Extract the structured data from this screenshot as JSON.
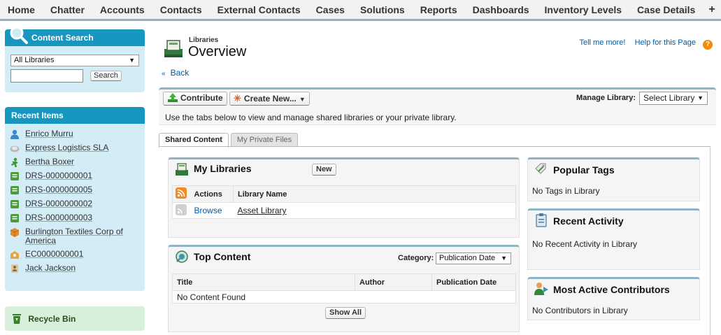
{
  "top_tabs": [
    "Home",
    "Chatter",
    "Accounts",
    "Contacts",
    "External Contacts",
    "Cases",
    "Solutions",
    "Reports",
    "Dashboards",
    "Inventory Levels",
    "Case Details",
    "+"
  ],
  "sidebar": {
    "content_search": {
      "title": "Content Search",
      "library_select": "All Libraries",
      "search_value": "",
      "search_button": "Search"
    },
    "recent_items": {
      "title": "Recent Items",
      "items": [
        {
          "label": "Enrico Murru",
          "icon": "contact-person-icon"
        },
        {
          "label": "Express Logistics SLA",
          "icon": "entitlement-icon"
        },
        {
          "label": "Bertha Boxer",
          "icon": "lead-icon"
        },
        {
          "label": "DRS-0000000001",
          "icon": "custom-record-icon"
        },
        {
          "label": "DRS-0000000005",
          "icon": "custom-record-icon"
        },
        {
          "label": "DRS-0000000002",
          "icon": "custom-record-icon"
        },
        {
          "label": "DRS-0000000003",
          "icon": "custom-record-icon"
        },
        {
          "label": "Burlington Textiles Corp of America",
          "icon": "account-icon"
        },
        {
          "label": "EC0000000001",
          "icon": "external-contact-icon"
        },
        {
          "label": "Jack Jackson",
          "icon": "user-card-icon"
        }
      ]
    },
    "recycle_bin": "Recycle Bin"
  },
  "header": {
    "type_label": "Libraries",
    "title": "Overview",
    "tell_me_more": "Tell me more!",
    "help": "Help for this Page",
    "back": "Back"
  },
  "toolbar": {
    "contribute": "Contribute",
    "create_new": "Create New...",
    "manage_label": "Manage Library:",
    "manage_select": "Select Library",
    "description": "Use the tabs below to view and manage shared libraries or your private library."
  },
  "subtabs": {
    "shared": "Shared Content",
    "private": "My Private Files"
  },
  "my_libraries": {
    "title": "My Libraries",
    "new_button": "New",
    "columns": [
      "Actions",
      "Library Name"
    ],
    "rows": [
      {
        "action": "Browse",
        "name": "Asset Library"
      }
    ]
  },
  "top_content": {
    "title": "Top Content",
    "category_label": "Category:",
    "category_value": "Publication Date",
    "columns": [
      "Title",
      "Author",
      "Publication Date"
    ],
    "empty": "No Content Found",
    "show_all": "Show All"
  },
  "popular_tags": {
    "title": "Popular Tags",
    "text": "No Tags in Library"
  },
  "recent_activity": {
    "title": "Recent Activity",
    "text": "No Recent Activity in Library"
  },
  "contributors": {
    "title": "Most Active Contributors",
    "text": "No Contributors in Library"
  },
  "colors": {
    "accent": "#1797c0",
    "tab_border": "#8fb4c7",
    "link": "#015ba7"
  }
}
